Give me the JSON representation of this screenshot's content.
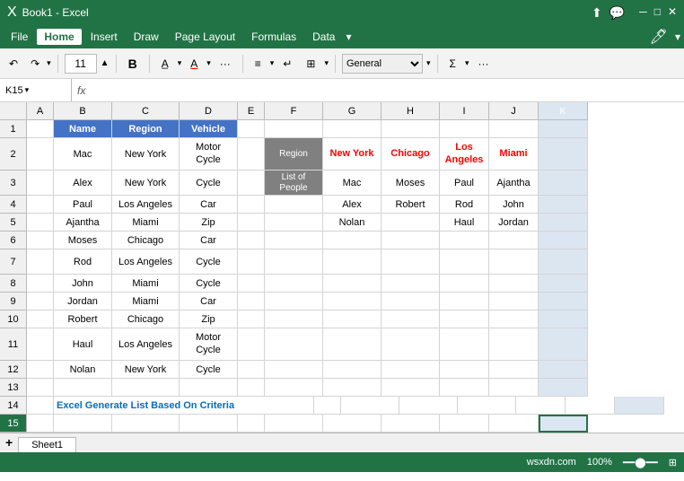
{
  "app": {
    "title": "Microsoft Excel",
    "file": "Book1 - Excel"
  },
  "menu": {
    "items": [
      "File",
      "Home",
      "Insert",
      "Draw",
      "Page Layout",
      "Formulas",
      "Data",
      ""
    ]
  },
  "toolbar": {
    "font_size": "11",
    "bold": "B",
    "more": "···",
    "number_format": "General"
  },
  "formula_bar": {
    "cell_ref": "K15",
    "fx": "fx"
  },
  "columns": [
    "",
    "A",
    "B",
    "C",
    "D",
    "E",
    "F",
    "G",
    "H",
    "I",
    "J",
    "K"
  ],
  "main_table": {
    "headers": [
      "Name",
      "Region",
      "Vehicle"
    ],
    "rows": [
      [
        "Mac",
        "New York",
        "Motor Cycle"
      ],
      [
        "Alex",
        "New York",
        "Cycle"
      ],
      [
        "Paul",
        "Los Angeles",
        "Car"
      ],
      [
        "Ajantha",
        "Miami",
        "Zip"
      ],
      [
        "Moses",
        "Chicago",
        "Car"
      ],
      [
        "Rod",
        "Los Angeles",
        "Cycle"
      ],
      [
        "John",
        "Miami",
        "Cycle"
      ],
      [
        "Jordan",
        "Miami",
        "Car"
      ],
      [
        "Robert",
        "Chicago",
        "Zip"
      ],
      [
        "Haul",
        "Los Angeles",
        "Motor Cycle"
      ],
      [
        "Nolan",
        "New York",
        "Cycle"
      ]
    ]
  },
  "pivot_table": {
    "col_headers": [
      "Region",
      "New York",
      "Chicago",
      "Los Angeles",
      "Miami"
    ],
    "row_header": "List of People",
    "rows": [
      [
        "Mac",
        "Moses",
        "Paul",
        "Ajantha"
      ],
      [
        "Alex",
        "Robert",
        "Rod",
        "John"
      ],
      [
        "Nolan",
        "",
        "Haul",
        "Jordan"
      ]
    ]
  },
  "footer_text": "Excel Generate List Based On Criteria",
  "sheet_tab": "Sheet1",
  "status": "wsxdn.com",
  "colors": {
    "header_bg": "#4472C4",
    "gray_header": "#808080",
    "red": "#FF0000",
    "blue_link": "#0070C0",
    "excel_green": "#217346",
    "selected_col": "#dce6f1"
  }
}
